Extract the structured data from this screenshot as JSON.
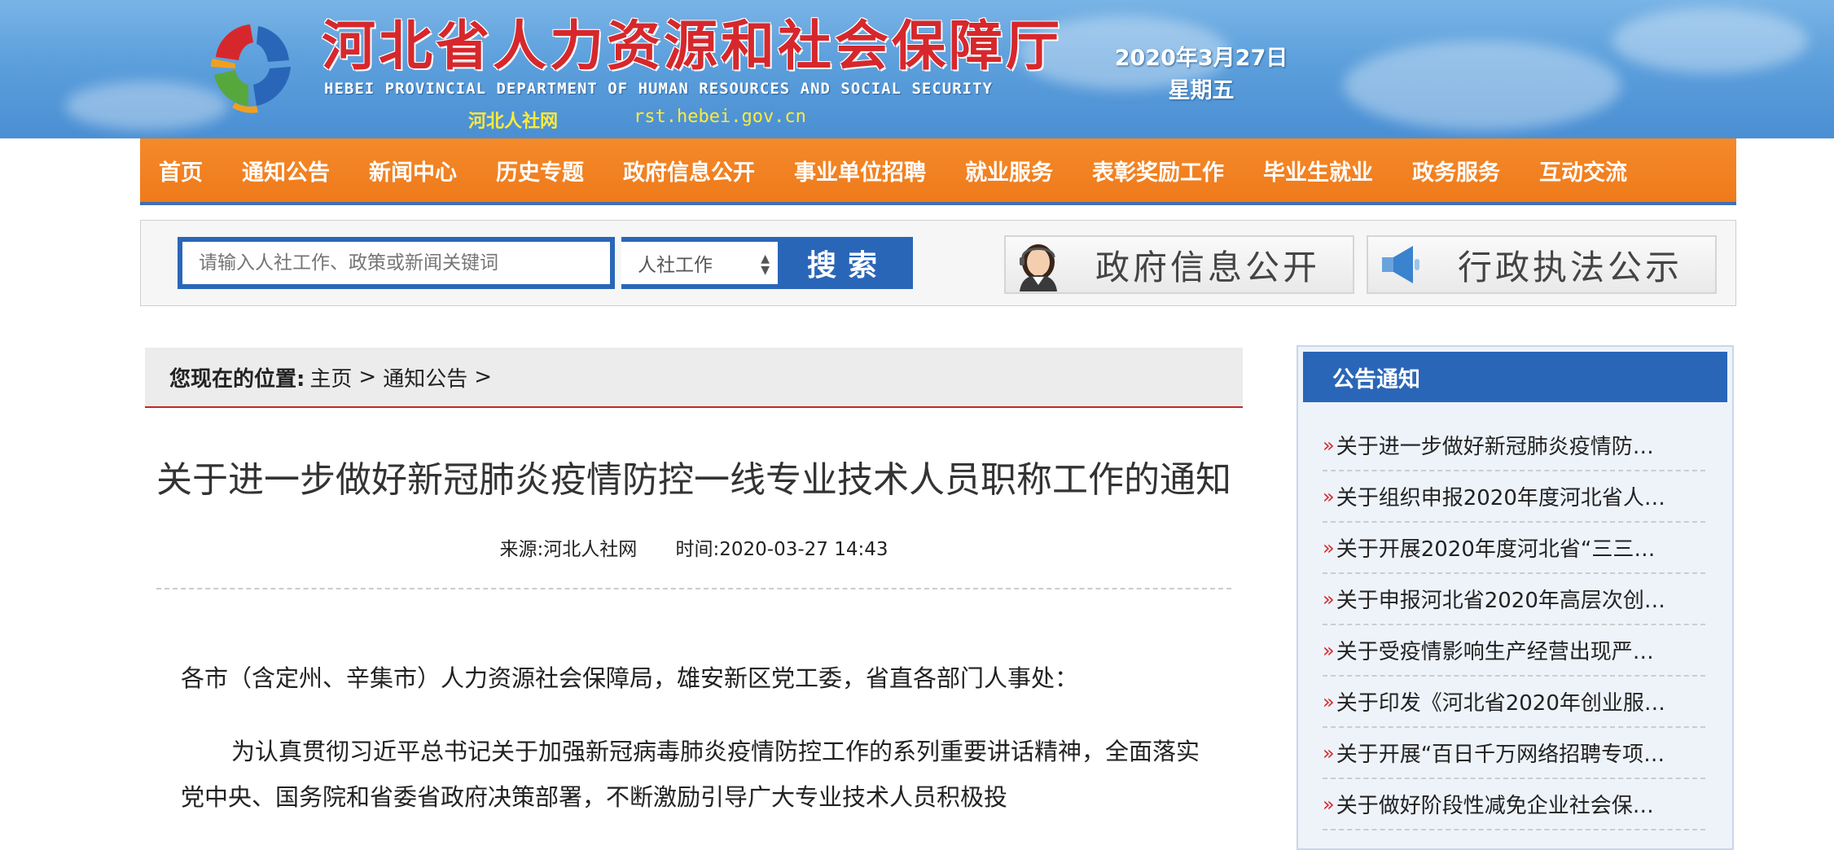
{
  "header": {
    "title": "河北省人力资源和社会保障厅",
    "subtitle_en": "HEBEI PROVINCIAL DEPARTMENT OF HUMAN RESOURCES AND SOCIAL SECURITY",
    "short_name": "河北人社网",
    "url": "rst.hebei.gov.cn",
    "date": "2020年3月27日",
    "weekday": "星期五",
    "colors": {
      "banner": "#5c9fdc",
      "title": "#d6282c"
    }
  },
  "nav": {
    "items": [
      {
        "label": "首页"
      },
      {
        "label": "通知公告"
      },
      {
        "label": "新闻中心"
      },
      {
        "label": "历史专题"
      },
      {
        "label": "政府信息公开"
      },
      {
        "label": "事业单位招聘"
      },
      {
        "label": "就业服务"
      },
      {
        "label": "表彰奖励工作"
      },
      {
        "label": "毕业生就业"
      },
      {
        "label": "政务服务"
      },
      {
        "label": "互动交流"
      }
    ],
    "color": "#ef7a1b"
  },
  "search": {
    "placeholder": "请输入人社工作、政策或新闻关键词",
    "category": "人社工作",
    "button": "搜索"
  },
  "quick_links": [
    {
      "label": "政府信息公开",
      "icon": "operator-woman-icon"
    },
    {
      "label": "行政执法公示",
      "icon": "megaphone-icon"
    }
  ],
  "breadcrumb": {
    "label": "您现在的位置:",
    "items": [
      "主页",
      "通知公告"
    ],
    "separator": ">"
  },
  "article": {
    "title": "关于进一步做好新冠肺炎疫情防控一线专业技术人员职称工作的通知",
    "source": "来源:河北人社网",
    "time": "时间:2020-03-27 14:43",
    "paragraphs": [
      "各市（含定州、辛集市）人力资源社会保障局，雄安新区党工委，省直各部门人事处：",
      "为认真贯彻习近平总书记关于加强新冠病毒肺炎疫情防控工作的系列重要讲话精神，全面落实党中央、国务院和省委省政府决策部署，不断激励引导广大专业技术人员积极投"
    ]
  },
  "sidebar": {
    "title": "公告通知",
    "items": [
      "关于进一步做好新冠肺炎疫情防…",
      "关于组织申报2020年度河北省人…",
      "关于开展2020年度河北省“三三…",
      "关于申报河北省2020年高层次创…",
      "关于受疫情影响生产经营出现严…",
      "关于印发《河北省2020年创业服…",
      "关于开展“百日千万网络招聘专项…",
      "关于做好阶段性减免企业社会保…"
    ],
    "color": "#2a66b8"
  }
}
